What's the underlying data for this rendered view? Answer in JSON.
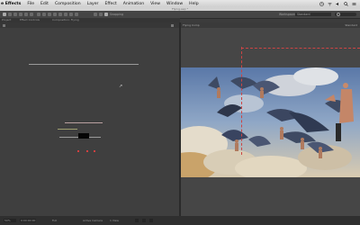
{
  "menubar": {
    "app_name": "e Effects",
    "items": [
      "File",
      "Edit",
      "Composition",
      "Layer",
      "Effect",
      "Animation",
      "View",
      "Window",
      "Help"
    ],
    "right_icons": [
      "clock-icon",
      "wifi-icon",
      "sound-icon",
      "search-icon",
      "list-icon"
    ]
  },
  "window": {
    "title": "Flying.aep *"
  },
  "toolbar": {
    "snapping_label": "Snapping",
    "workspace_label": "Workspace:",
    "workspace_value": "Standard"
  },
  "left_panel": {
    "tabs": [
      "Project",
      "Effect Controls",
      "Composition: Flying"
    ]
  },
  "viewer": {
    "title": "Flying Comp",
    "right_label": "Standard",
    "colors": {
      "sky_top": "#5a78a8",
      "sky_mid": "#8fa7c6",
      "cloud": "#e4dccb",
      "warm_cloud": "#c9a36a",
      "figure_skin": "#b07a5e",
      "wing": "#3e4a63"
    }
  },
  "statusbar": {
    "zoom": "50%",
    "timecode": "0:00:00:00",
    "resolution": "Full",
    "camera": "Active Camera",
    "view": "1 View"
  },
  "accent_color": "#d04040"
}
